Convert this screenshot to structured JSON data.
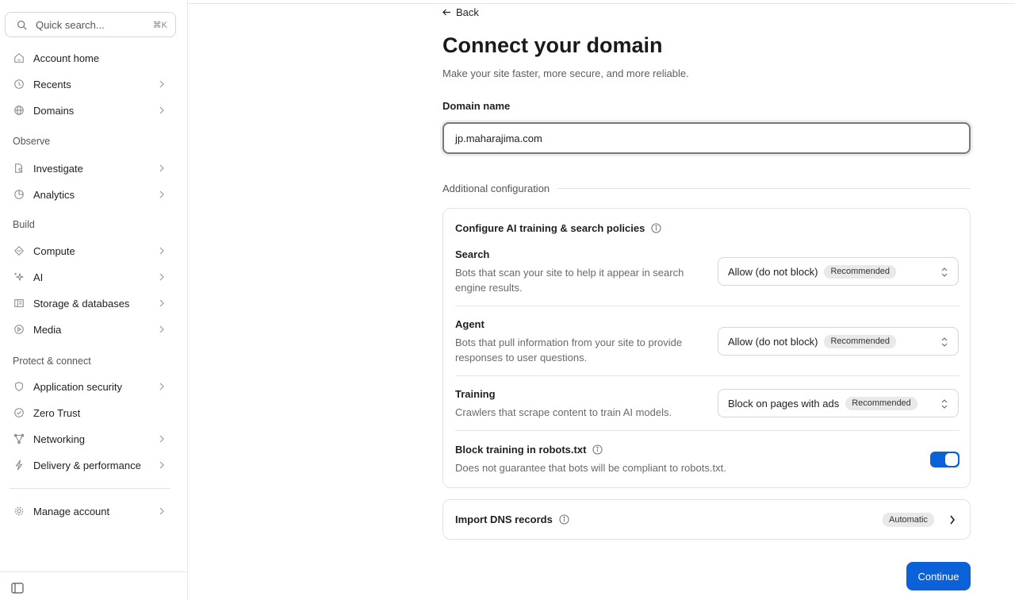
{
  "sidebar": {
    "search": {
      "placeholder": "Quick search...",
      "shortcut": "⌘K"
    },
    "items": [
      {
        "label": "Account home"
      },
      {
        "label": "Recents"
      },
      {
        "label": "Domains"
      },
      {
        "label": "Investigate"
      },
      {
        "label": "Analytics"
      },
      {
        "label": "Compute"
      },
      {
        "label": "AI"
      },
      {
        "label": "Storage & databases"
      },
      {
        "label": "Media"
      },
      {
        "label": "Application security"
      },
      {
        "label": "Zero Trust"
      },
      {
        "label": "Networking"
      },
      {
        "label": "Delivery & performance"
      },
      {
        "label": "Manage account"
      }
    ],
    "sections": {
      "observe": "Observe",
      "build": "Build",
      "protect": "Protect & connect"
    }
  },
  "main": {
    "back_label": "Back",
    "title": "Connect your domain",
    "subtitle": "Make your site faster, more secure, and more reliable.",
    "domain_label": "Domain name",
    "domain_value": "jp.maharajima.com",
    "additional_config": "Additional configuration",
    "ai_card": {
      "title": "Configure AI training & search policies",
      "rows": [
        {
          "name": "Search",
          "desc": "Bots that scan your site to help it appear in search engine results.",
          "select": "Allow (do not block)",
          "badge": "Recommended"
        },
        {
          "name": "Agent",
          "desc": "Bots that pull information from your site to provide responses to user questions.",
          "select": "Allow (do not block)",
          "badge": "Recommended"
        },
        {
          "name": "Training",
          "desc": "Crawlers that scrape content to train AI models.",
          "select": "Block on pages with ads",
          "badge": "Recommended"
        }
      ],
      "robots": {
        "name": "Block training in robots.txt",
        "desc": "Does not guarantee that bots will be compliant to robots.txt.",
        "enabled": true
      }
    },
    "dns_card": {
      "title": "Import DNS records",
      "badge": "Automatic"
    },
    "continue_label": "Continue"
  },
  "colors": {
    "accent": "#0b61d8"
  }
}
